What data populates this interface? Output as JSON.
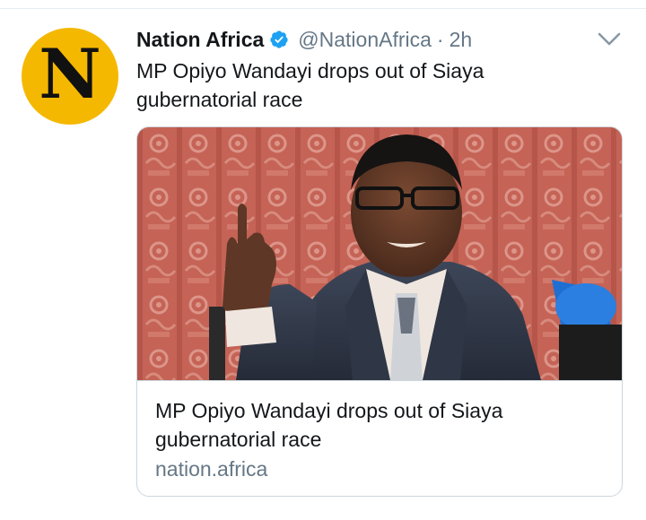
{
  "tweet": {
    "author": {
      "display_name": "Nation Africa",
      "handle": "@NationAfrica",
      "verified": true,
      "avatar_letter": "N",
      "avatar_color": "#f5b800"
    },
    "separator": "·",
    "timestamp": "2h",
    "text": "MP Opiyo Wandayi drops out of Siaya gubernatorial race",
    "menu_icon": "chevron-down-icon",
    "card": {
      "title": "MP Opiyo Wandayi drops out of Siaya gubernatorial race",
      "domain": "nation.africa"
    }
  },
  "colors": {
    "verified_blue": "#1da1f2",
    "secondary_text": "#657786",
    "primary_text": "#14171a",
    "border": "#ccd6dd"
  }
}
